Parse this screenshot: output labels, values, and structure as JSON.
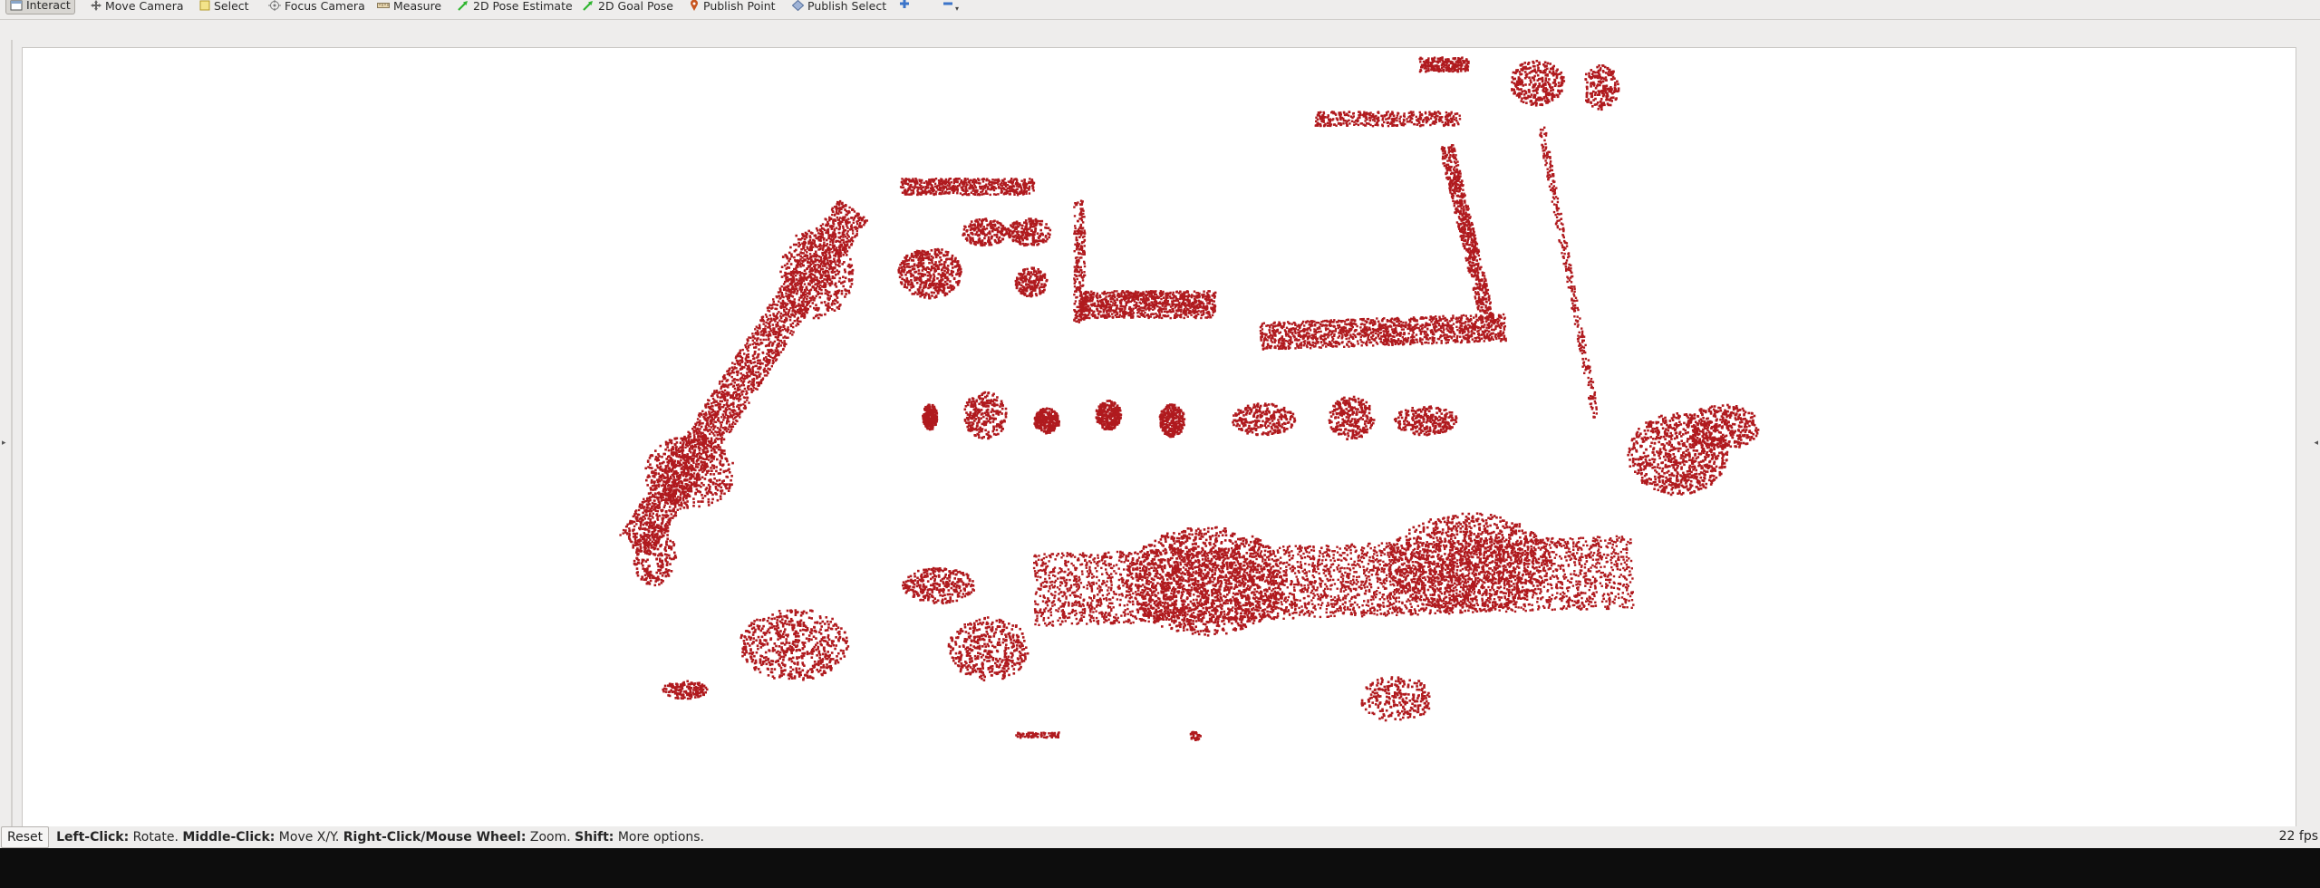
{
  "toolbar": {
    "tools": [
      {
        "label": "Interact",
        "icon": "cursor-icon",
        "active": true
      },
      {
        "label": "Move Camera",
        "icon": "move-arrows-icon",
        "active": false
      },
      {
        "label": "Select",
        "icon": "select-box-icon",
        "active": false
      },
      {
        "label": "Focus Camera",
        "icon": "focus-target-icon",
        "active": false
      },
      {
        "label": "Measure",
        "icon": "ruler-icon",
        "active": false
      },
      {
        "label": "2D Pose Estimate",
        "icon": "green-arrow-icon",
        "active": false
      },
      {
        "label": "2D Goal Pose",
        "icon": "green-arrow-icon",
        "active": false
      },
      {
        "label": "Publish Point",
        "icon": "map-pin-icon",
        "active": false
      },
      {
        "label": "Publish Select",
        "icon": "select-diamond-icon",
        "active": false
      }
    ],
    "add_tool_icon": "plus-icon",
    "remove_tool_icon": "minus-icon"
  },
  "viewport": {
    "background": "#ffffff",
    "point_color": "#b01a1e",
    "content": "point-cloud-map"
  },
  "statusbar": {
    "reset_label": "Reset",
    "hint_left_key": "Left-Click:",
    "hint_left_action": " Rotate. ",
    "hint_middle_key": "Middle-Click:",
    "hint_middle_action": " Move X/Y. ",
    "hint_right_key": "Right-Click/Mouse Wheel:",
    "hint_right_action": " Zoom. ",
    "hint_shift_key": "Shift:",
    "hint_shift_action": " More options.",
    "fps": "22 fps"
  },
  "colors": {
    "panel_bg": "#eeedec",
    "point_cloud": "#b01a1e",
    "accent_green": "#2fb52f"
  }
}
